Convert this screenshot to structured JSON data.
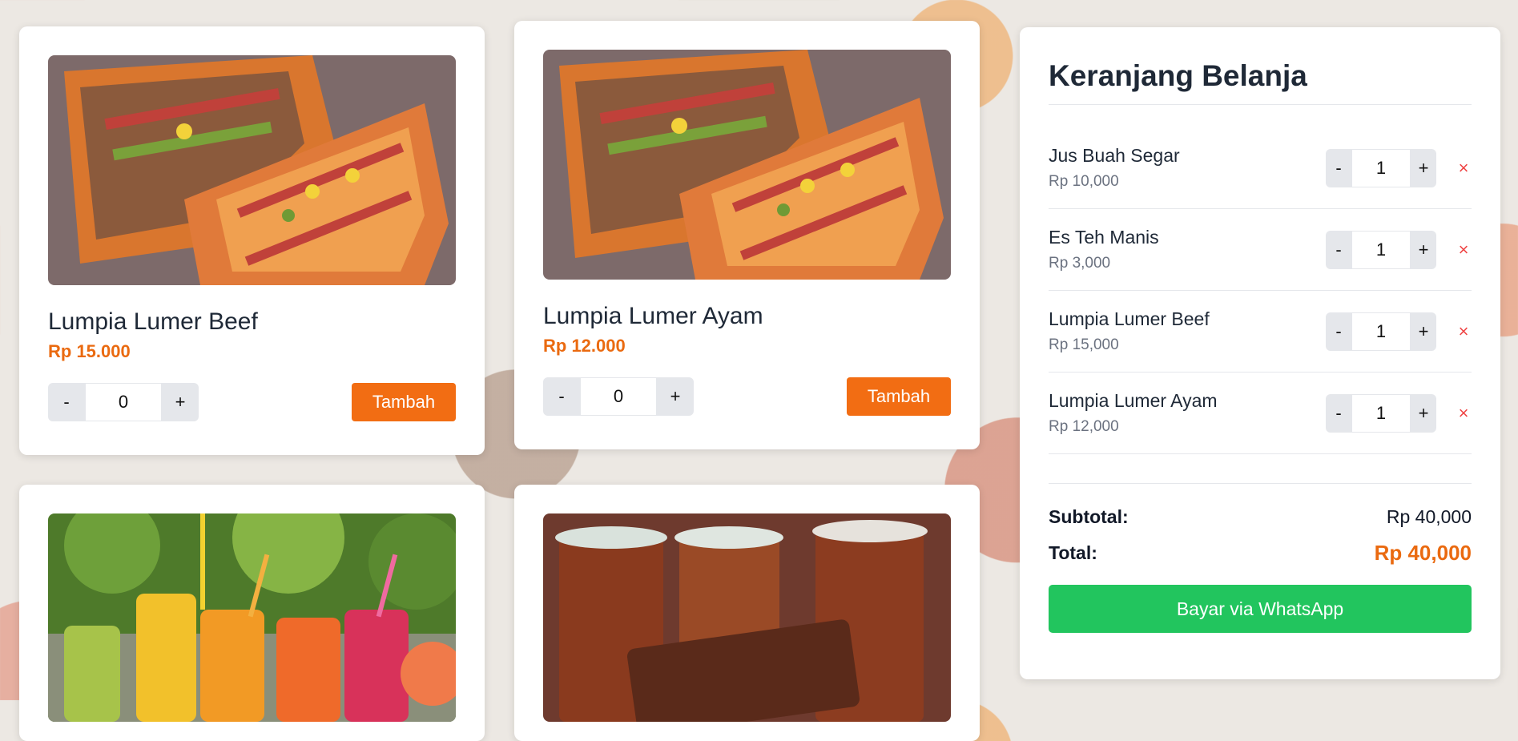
{
  "products": [
    {
      "name": "Lumpia Lumer Beef",
      "price": "Rp 15.000",
      "qty": "0",
      "minus": "-",
      "plus": "+",
      "add_label": "Tambah"
    },
    {
      "name": "Lumpia Lumer Ayam",
      "price": "Rp 12.000",
      "qty": "0",
      "minus": "-",
      "plus": "+",
      "add_label": "Tambah"
    }
  ],
  "cart": {
    "title": "Keranjang Belanja",
    "items": [
      {
        "name": "Jus Buah Segar",
        "price": "Rp 10,000",
        "qty": "1",
        "minus": "-",
        "plus": "+",
        "remove": "×"
      },
      {
        "name": "Es Teh Manis",
        "price": "Rp 3,000",
        "qty": "1",
        "minus": "-",
        "plus": "+",
        "remove": "×"
      },
      {
        "name": "Lumpia Lumer Beef",
        "price": "Rp 15,000",
        "qty": "1",
        "minus": "-",
        "plus": "+",
        "remove": "×"
      },
      {
        "name": "Lumpia Lumer Ayam",
        "price": "Rp 12,000",
        "qty": "1",
        "minus": "-",
        "plus": "+",
        "remove": "×"
      }
    ],
    "subtotal_label": "Subtotal:",
    "subtotal_value": "Rp 40,000",
    "total_label": "Total:",
    "total_value": "Rp 40,000",
    "checkout_label": "Bayar via WhatsApp"
  },
  "colors": {
    "accent": "#f26d13",
    "price": "#ea6a10",
    "whatsapp": "#22c55e",
    "remove": "#ef4444"
  }
}
